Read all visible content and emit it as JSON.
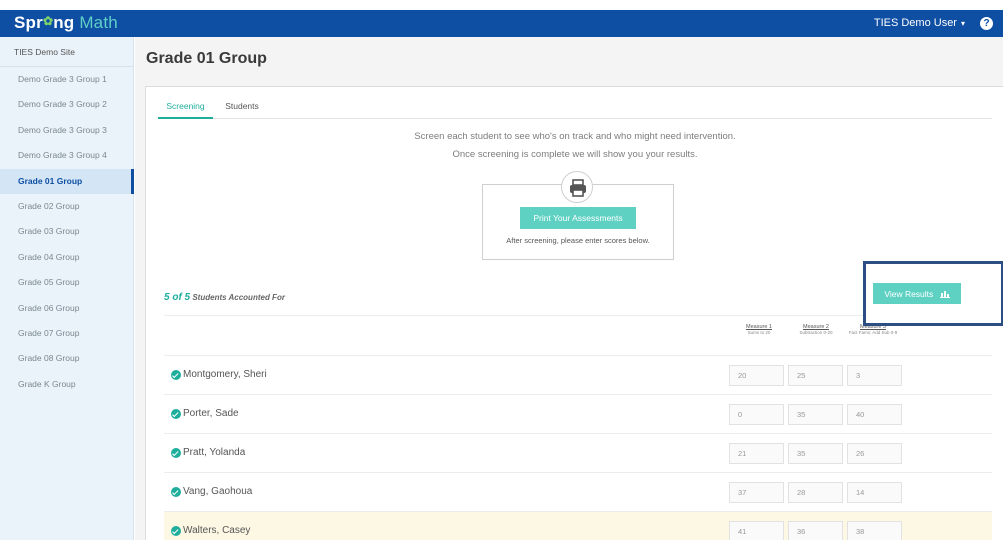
{
  "app": {
    "logo_pre": "Spr",
    "logo_leaf": "✿",
    "logo_mid": "ng",
    "logo_math": " Math"
  },
  "user": {
    "name": "TIES Demo User",
    "caret": "▾",
    "help": "?"
  },
  "sidebar": {
    "site": "TIES Demo Site",
    "items": [
      "Demo Grade 3 Group 1",
      "Demo Grade 3 Group 2",
      "Demo Grade 3 Group 3",
      "Demo Grade 3 Group 4",
      "Grade 01 Group",
      "Grade 02 Group",
      "Grade 03 Group",
      "Grade 04 Group",
      "Grade 05 Group",
      "Grade 06 Group",
      "Grade 07 Group",
      "Grade 08 Group",
      "Grade K Group"
    ]
  },
  "page": {
    "title": "Grade 01 Group"
  },
  "tabs": {
    "screening": "Screening",
    "students": "Students"
  },
  "intro": {
    "line1": "Screen each student to see who's on track and who might need intervention.",
    "line2": "Once screening is complete we will show you your results."
  },
  "print": {
    "button": "Print Your Assessments",
    "note": "After screening, please enter scores below."
  },
  "accounted": {
    "count": "5 of 5",
    "label": " Students Accounted For"
  },
  "view_results": {
    "label": "View Results"
  },
  "measures": [
    {
      "name": "Measure 1",
      "desc": "Sums to 20"
    },
    {
      "name": "Measure 2",
      "desc": "Subtraction 0-20"
    },
    {
      "name": "Measure 3",
      "desc": "Fact Fams: Add Sub 0-9"
    }
  ],
  "students": [
    {
      "name": "Montgomery, Sheri",
      "scores": [
        "20",
        "25",
        "3"
      ]
    },
    {
      "name": "Porter, Sade",
      "scores": [
        "0",
        "35",
        "40"
      ]
    },
    {
      "name": "Pratt, Yolanda",
      "scores": [
        "21",
        "35",
        "26"
      ]
    },
    {
      "name": "Vang, Gaohoua",
      "scores": [
        "37",
        "28",
        "14"
      ]
    },
    {
      "name": "Walters, Casey",
      "scores": [
        "41",
        "36",
        "38"
      ]
    }
  ],
  "colors": {
    "nav": "#0e4ea3",
    "accent": "#5ed1c3",
    "accent_text": "#1fae9c",
    "highlight_box": "#2d4e83"
  }
}
